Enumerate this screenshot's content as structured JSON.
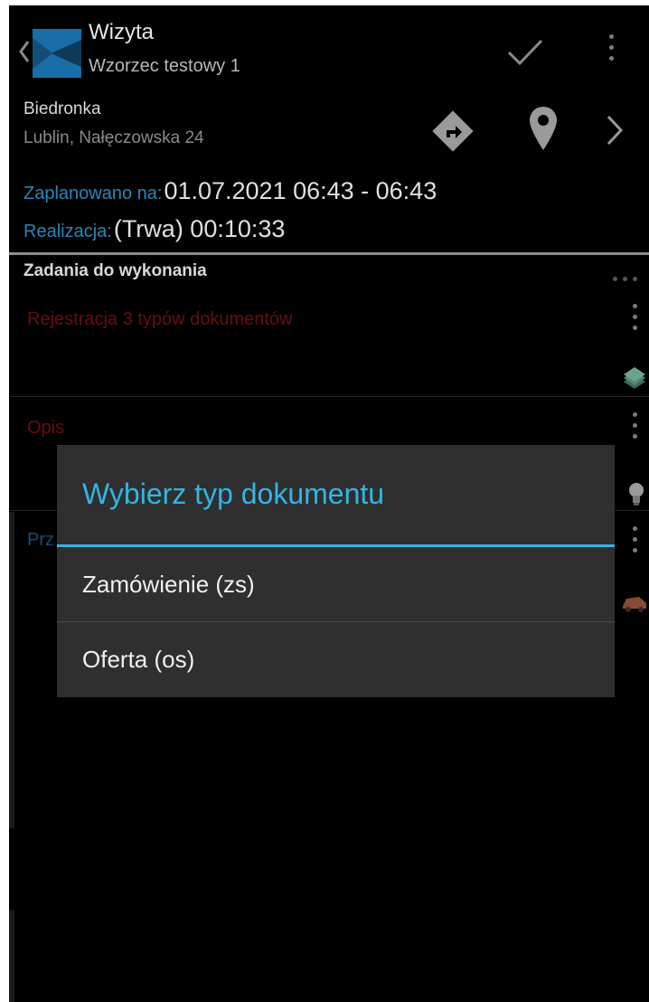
{
  "header": {
    "title": "Wizyta",
    "subtitle": "Wzorzec testowy 1",
    "icons": {
      "back": "chevron-left-icon",
      "logo": "app-logo-icon",
      "confirm": "checkmark-icon",
      "menu": "overflow-menu-icon"
    }
  },
  "client": {
    "name": "Biedronka",
    "address": "Lublin, Nałęczowska 24",
    "icons": {
      "directions": "directions-icon",
      "location": "map-pin-icon",
      "next": "chevron-right-icon"
    }
  },
  "schedule": {
    "planned_label": "Zaplanowano na:",
    "planned_value": "01.07.2021 06:43 - 06:43",
    "realization_label": "Realizacja:",
    "realization_value": "(Trwa) 00:10:33"
  },
  "tasks": {
    "header": "Zadania do wykonania",
    "items": [
      {
        "title": "Rejestracja 3 typów dokumentów",
        "icon": "document-stack-icon"
      },
      {
        "title": "Opis",
        "icon": "lightbulb-icon"
      },
      {
        "title": "Prz",
        "icon": "car-icon"
      }
    ]
  },
  "dialog": {
    "title": "Wybierz typ dokumentu",
    "options": [
      {
        "label": "Zamówienie (zs)"
      },
      {
        "label": "Oferta (os)"
      }
    ]
  },
  "colors": {
    "accent": "#33b5e5",
    "label_blue": "#2a86b8",
    "task_red": "#6a0d0d",
    "dialog_bg": "#2f2f2f",
    "background": "#000000"
  }
}
